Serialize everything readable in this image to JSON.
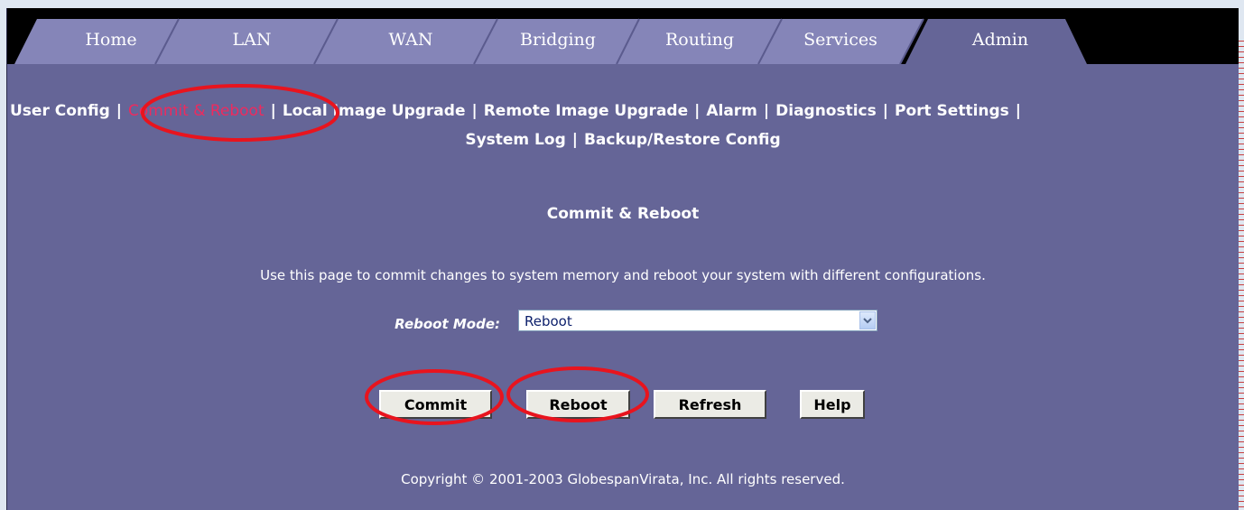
{
  "tabs": [
    {
      "label": "Home"
    },
    {
      "label": "LAN"
    },
    {
      "label": "WAN"
    },
    {
      "label": "Bridging"
    },
    {
      "label": "Routing"
    },
    {
      "label": "Services"
    },
    {
      "label": "Admin",
      "active": true
    }
  ],
  "subnav": {
    "row1": [
      {
        "label": "User Config"
      },
      {
        "label": "Commit & Reboot",
        "active": true
      },
      {
        "label": "Local Image Upgrade"
      },
      {
        "label": "Remote Image Upgrade"
      },
      {
        "label": "Alarm"
      },
      {
        "label": "Diagnostics"
      },
      {
        "label": "Port Settings"
      }
    ],
    "row2": [
      {
        "label": "System Log"
      },
      {
        "label": "Backup/Restore Config"
      }
    ],
    "separator": "|"
  },
  "page": {
    "title": "Commit & Reboot",
    "description": "Use this page to commit changes to system memory and reboot your system with different configurations.",
    "reboot_mode_label": "Reboot Mode:",
    "reboot_mode_value": "Reboot"
  },
  "buttons": {
    "commit": "Commit",
    "reboot": "Reboot",
    "refresh": "Refresh",
    "help": "Help"
  },
  "footer": {
    "copyright": "Copyright © 2001-2003 GlobespanVirata, Inc. All rights reserved."
  },
  "colors": {
    "background": "#656597",
    "tab_inactive": "#8585b8",
    "tab_active": "#656597",
    "active_link": "#ee2a5e",
    "annotation": "#e8141e"
  }
}
